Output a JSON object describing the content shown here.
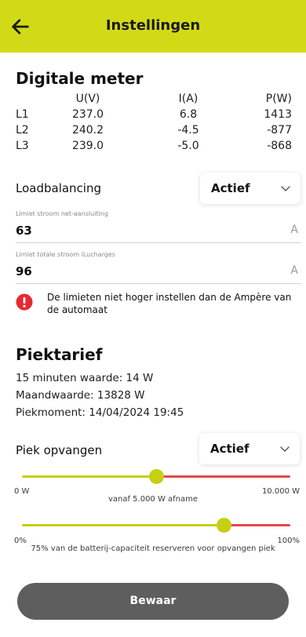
{
  "header": {
    "title": "Instellingen"
  },
  "meter": {
    "title": "Digitale meter",
    "headers": [
      "",
      "U(V)",
      "I(A)",
      "P(W)"
    ],
    "rows": [
      [
        "L1",
        "237.0",
        "6.8",
        "1413"
      ],
      [
        "L2",
        "240.2",
        "-4.5",
        "-877"
      ],
      [
        "L3",
        "239.0",
        "-5.0",
        "-868"
      ]
    ]
  },
  "loadbalancing": {
    "label": "Loadbalancing",
    "value": "Actief"
  },
  "limit_grid": {
    "label": "Limiet stroom net-aansluiting",
    "value": "63",
    "unit": "A"
  },
  "limit_total": {
    "label": "Limiet totale stroom iLucharges",
    "value": "96",
    "unit": "A"
  },
  "warning": {
    "text": "De limieten niet hoger instellen dan de Ampère van de automaat"
  },
  "piek": {
    "title": "Piektarief",
    "quarter": "15 minuten waarde: 14 W",
    "month": "Maandwaarde: 13828 W",
    "moment": "Piekmoment: 14/04/2024 19:45",
    "catch_label": "Piek opvangen",
    "catch_value": "Actief"
  },
  "slider_power": {
    "min_label": "0 W",
    "max_label": "10.000 W",
    "caption": "vanaf 5.000 W afname",
    "fraction": 0.5
  },
  "slider_battery": {
    "min_label": "0%",
    "max_label": "100%",
    "caption": "75% van de batterij-capaciteit reserveren voor opvangen piek",
    "fraction": 0.75
  },
  "save_label": "Bewaar",
  "colors": {
    "accent": "#d2da17",
    "slider_active": "#c6cf12",
    "slider_inactive": "#e4474b",
    "error": "#e32b35",
    "button": "#5e5e5e"
  },
  "icons": {
    "back": "arrow-left-icon",
    "chevron": "chevron-down-icon",
    "warning": "alert-circle-icon"
  }
}
